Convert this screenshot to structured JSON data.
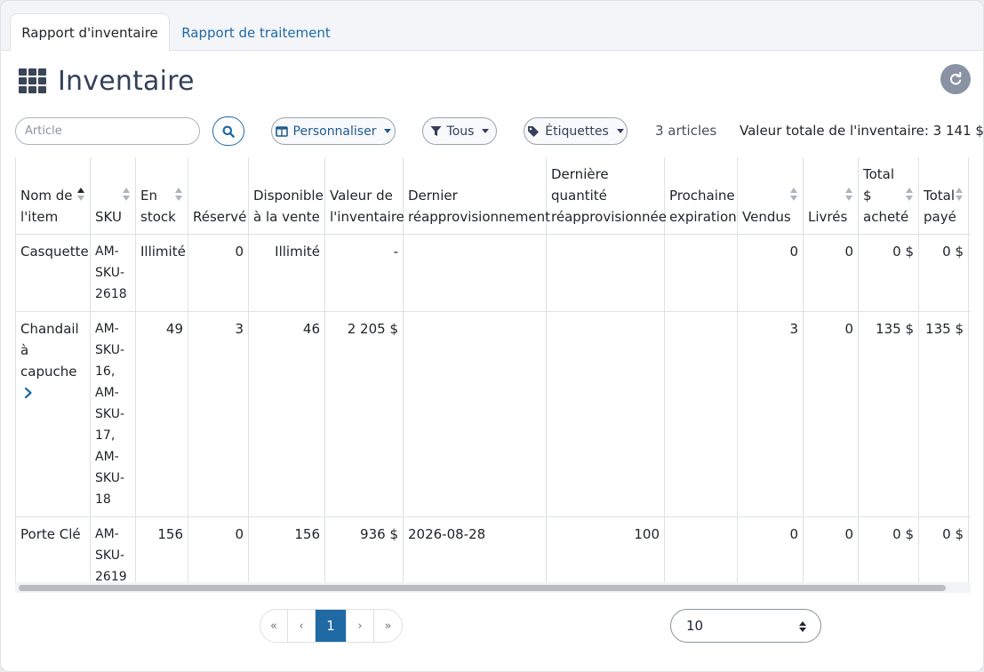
{
  "tabs": [
    {
      "label": "Rapport d'inventaire",
      "active": true
    },
    {
      "label": "Rapport de traitement",
      "active": false
    }
  ],
  "page": {
    "title": "Inventaire"
  },
  "toolbar": {
    "search_placeholder": "Article",
    "customize_label": "Personnaliser",
    "filter_label": "Tous",
    "tags_label": "Étiquettes",
    "count_text": "3 articles",
    "total_value_text": "Valeur totale de l'inventaire: 3 141 $"
  },
  "table": {
    "columns": [
      "Nom de l'item",
      "SKU",
      "En stock",
      "Réservé",
      "Disponible à la vente",
      "Valeur de l'inventaire",
      "Dernier réapprovisionnement",
      "Dernière quantité réapprovisionnée",
      "Prochaine expiration",
      "Vendus",
      "Livrés",
      "Total $ acheté",
      "Total payé"
    ],
    "rows": [
      {
        "name": "Casquette",
        "sku": "AM-SKU-2618",
        "in_stock": "Illimité",
        "reserved": "0",
        "available": "Illimité",
        "value": "-",
        "last_restock": "",
        "last_restock_qty": "",
        "next_expiry": "",
        "sold": "0",
        "delivered": "0",
        "total_bought": "0 $",
        "total_paid": "0 $"
      },
      {
        "name": "Chandail à capuche",
        "sku": "AM-SKU-16, AM-SKU-17, AM-SKU-18",
        "in_stock": "49",
        "reserved": "3",
        "available": "46",
        "value": "2 205 $",
        "last_restock": "",
        "last_restock_qty": "",
        "next_expiry": "",
        "sold": "3",
        "delivered": "0",
        "total_bought": "135 $",
        "total_paid": "135 $"
      },
      {
        "name": "Porte Clé",
        "sku": "AM-SKU-2619",
        "in_stock": "156",
        "reserved": "0",
        "available": "156",
        "value": "936 $",
        "last_restock": "2026-08-28",
        "last_restock_qty": "100",
        "next_expiry": "",
        "sold": "0",
        "delivered": "0",
        "total_bought": "0 $",
        "total_paid": "0 $"
      }
    ]
  },
  "pagination": {
    "first": "«",
    "prev": "‹",
    "current": "1",
    "next": "›",
    "last": "»",
    "page_size": "10"
  }
}
